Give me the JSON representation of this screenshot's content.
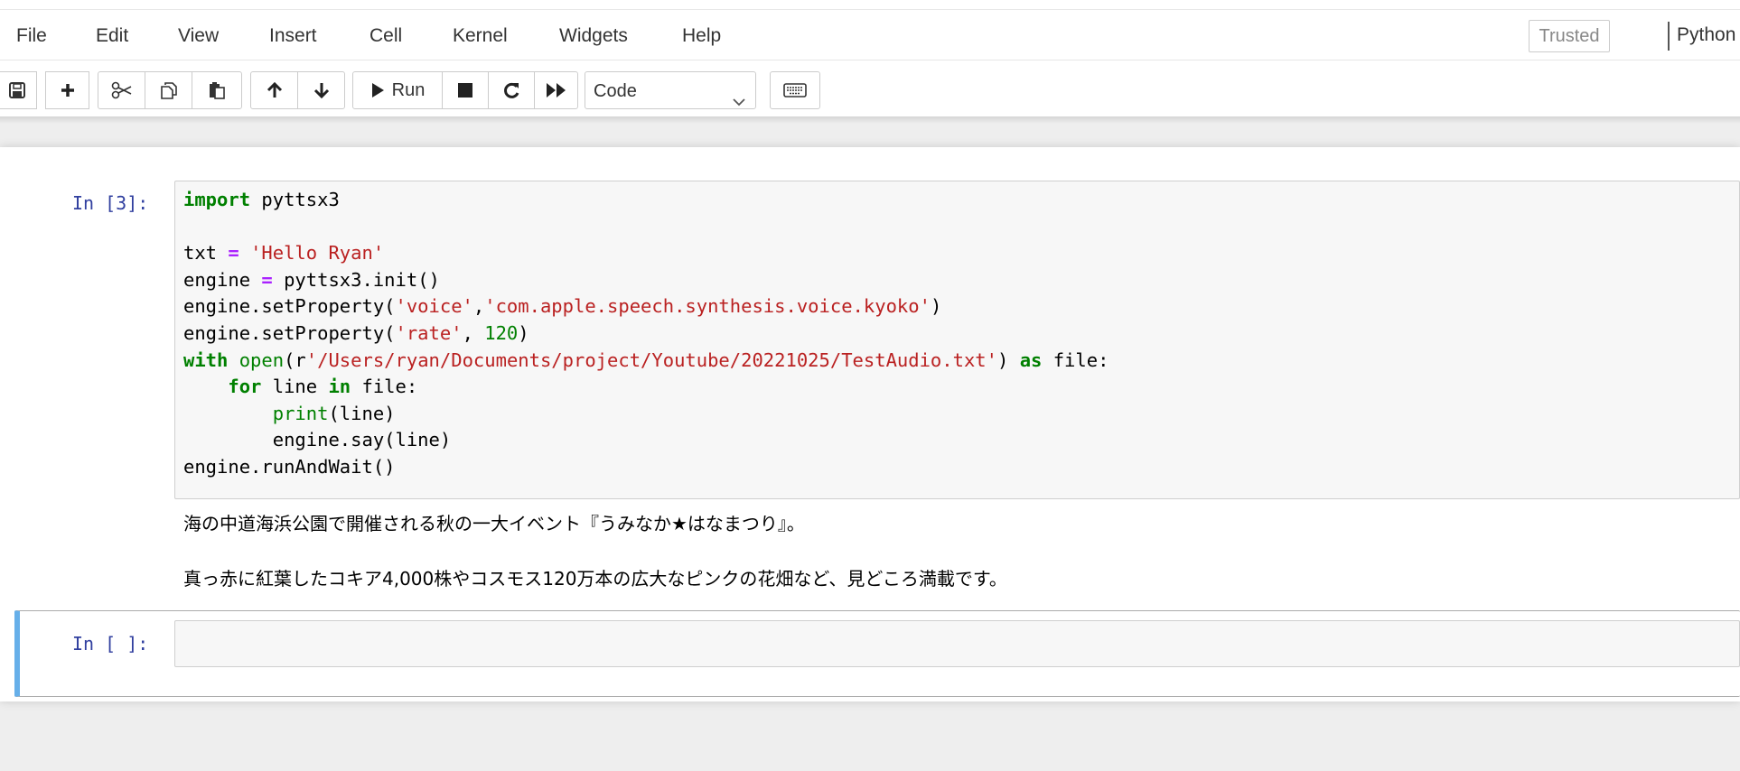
{
  "menubar": {
    "items": [
      "File",
      "Edit",
      "View",
      "Insert",
      "Cell",
      "Kernel",
      "Widgets",
      "Help"
    ],
    "trusted_label": "Trusted",
    "kernel_label": "Python"
  },
  "toolbar": {
    "run_label": "Run",
    "cell_type_value": "Code",
    "icons": [
      "save-icon",
      "plus-icon",
      "cut-icon",
      "copy-icon",
      "paste-icon",
      "arrow-up-icon",
      "arrow-down-icon",
      "play-icon",
      "stop-icon",
      "restart-icon",
      "fast-forward-icon",
      "chevron-down-icon",
      "keyboard-icon"
    ]
  },
  "cells": [
    {
      "prompt": "In [3]:",
      "code_lines": [
        "import pyttsx3",
        "",
        "txt = 'Hello Ryan'",
        "engine = pyttsx3.init()",
        "engine.setProperty('voice','com.apple.speech.synthesis.voice.kyoko')",
        "engine.setProperty('rate', 120)",
        "with open(r'/Users/ryan/Documents/project/Youtube/20221025/TestAudio.txt') as file:",
        "    for line in file:",
        "        print(line)",
        "        engine.say(line)",
        "engine.runAndWait()"
      ],
      "output_lines": [
        "海の中道海浜公園で開催される秋の一大イベント『うみなか★はなまつり』。",
        "真っ赤に紅葉したコキア4,000株やコスモス120万本の広大なピンクの花畑など、見どころ満載です。"
      ]
    },
    {
      "prompt": "In [ ]:"
    }
  ],
  "colors": {
    "prompt": "#303f9f",
    "keyword": "#008000",
    "string": "#ba2121",
    "operator": "#aa22ff",
    "selected_cell_border": "#66afe9"
  }
}
